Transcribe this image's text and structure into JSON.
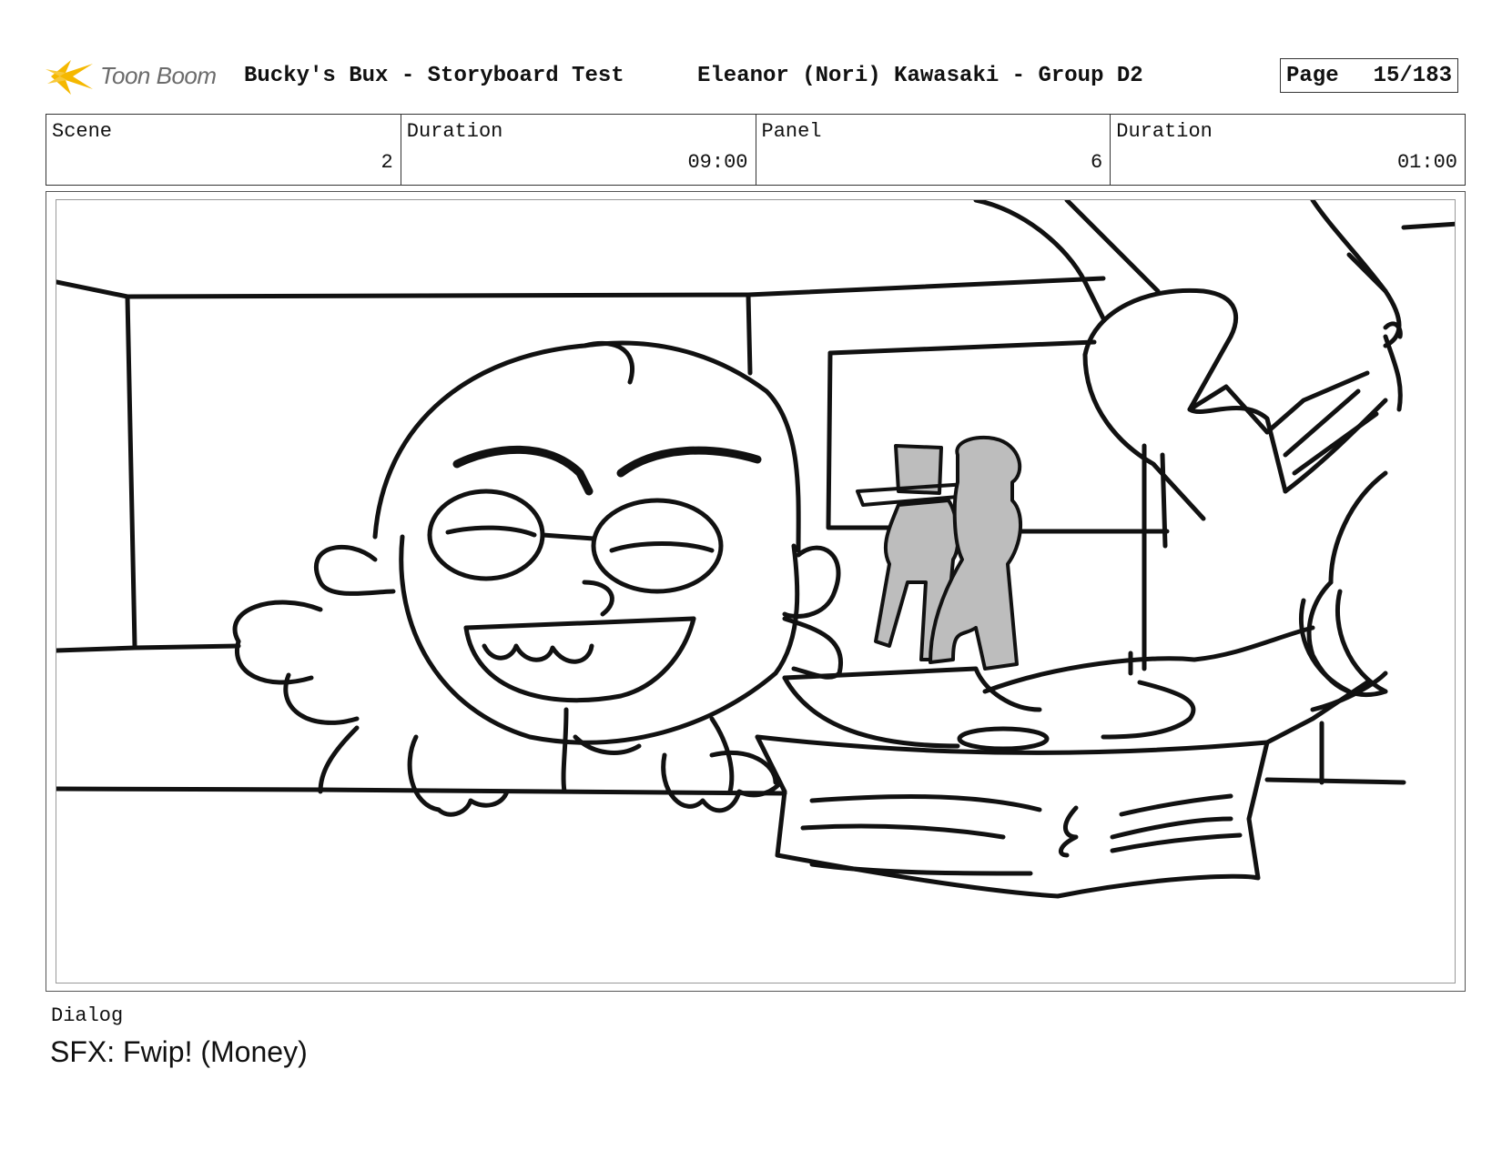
{
  "header": {
    "logo_text": "Toon Boom",
    "project_title": "Bucky's Bux - Storyboard Test",
    "artist": "Eleanor (Nori) Kawasaki - Group D2",
    "page_label": "Page",
    "page_value": "15/183"
  },
  "info": {
    "scene_label": "Scene",
    "scene_value": "2",
    "scene_duration_label": "Duration",
    "scene_duration_value": "09:00",
    "panel_label": "Panel",
    "panel_value": "6",
    "panel_duration_label": "Duration",
    "panel_duration_value": "01:00"
  },
  "dialog": {
    "label": "Dialog",
    "text": "SFX: Fwip! (Money)"
  },
  "colors": {
    "logo_yellow": "#f5b800",
    "line": "#111111",
    "fill_gray": "#bdbdbd"
  }
}
